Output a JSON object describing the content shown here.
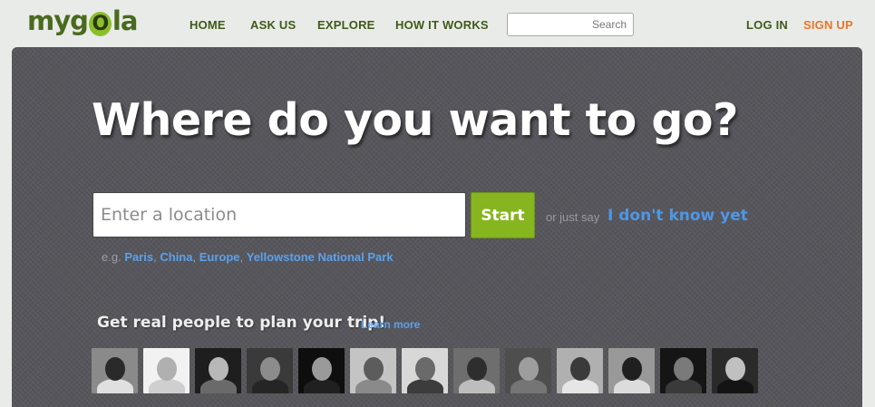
{
  "brand": {
    "prefix": "myg",
    "o": "O",
    "suffix": "la"
  },
  "nav": {
    "home": "HOME",
    "ask": "ASK US",
    "explore": "EXPLORE",
    "how": "HOW IT WORKS",
    "search_placeholder": "Search",
    "login": "LOG IN",
    "signup": "SIGN UP"
  },
  "hero": {
    "headline": "Where do you want to go?",
    "location_placeholder": "Enter a location",
    "start_label": "Start",
    "or_say": "or just say",
    "dont_know": "I don't know yet",
    "eg": "e.g.",
    "examples": [
      "Paris",
      "China",
      "Europe",
      "Yellowstone National Park"
    ],
    "tagline": "Get real people to plan your trip!",
    "learn_more": "Learn more"
  },
  "colors": {
    "accent_green": "#86b51f",
    "nav_green": "#3f5a19",
    "signup_orange": "#e8762a",
    "link_blue": "#4d97e6",
    "panel": "#57565c"
  },
  "avatars": [
    {
      "bg": "#8a8a8a",
      "head": "#2a2a2a",
      "body": "#e0e0e0"
    },
    {
      "bg": "#f2f2f2",
      "head": "#b0b0b0",
      "body": "#cfcfcf"
    },
    {
      "bg": "#1e1e1e",
      "head": "#b8b8b8",
      "body": "#6a6a6a"
    },
    {
      "bg": "#3a3a3a",
      "head": "#8c8c8c",
      "body": "#252525"
    },
    {
      "bg": "#0e0e0e",
      "head": "#9a9a9a",
      "body": "#202020"
    },
    {
      "bg": "#c4c4c4",
      "head": "#5c5c5c",
      "body": "#8a8a8a"
    },
    {
      "bg": "#d8d8d8",
      "head": "#6a6a6a",
      "body": "#3c3c3c"
    },
    {
      "bg": "#6e6e6e",
      "head": "#2e2e2e",
      "body": "#bdbdbd"
    },
    {
      "bg": "#4e4e4e",
      "head": "#9d9d9d",
      "body": "#757575"
    },
    {
      "bg": "#b0b0b0",
      "head": "#3a3a3a",
      "body": "#e6e6e6"
    },
    {
      "bg": "#999999",
      "head": "#1f1f1f",
      "body": "#dcdcdc"
    },
    {
      "bg": "#151515",
      "head": "#7a7a7a",
      "body": "#3a3a3a"
    },
    {
      "bg": "#2a2a2a",
      "head": "#c0c0c0",
      "body": "#141414"
    }
  ]
}
